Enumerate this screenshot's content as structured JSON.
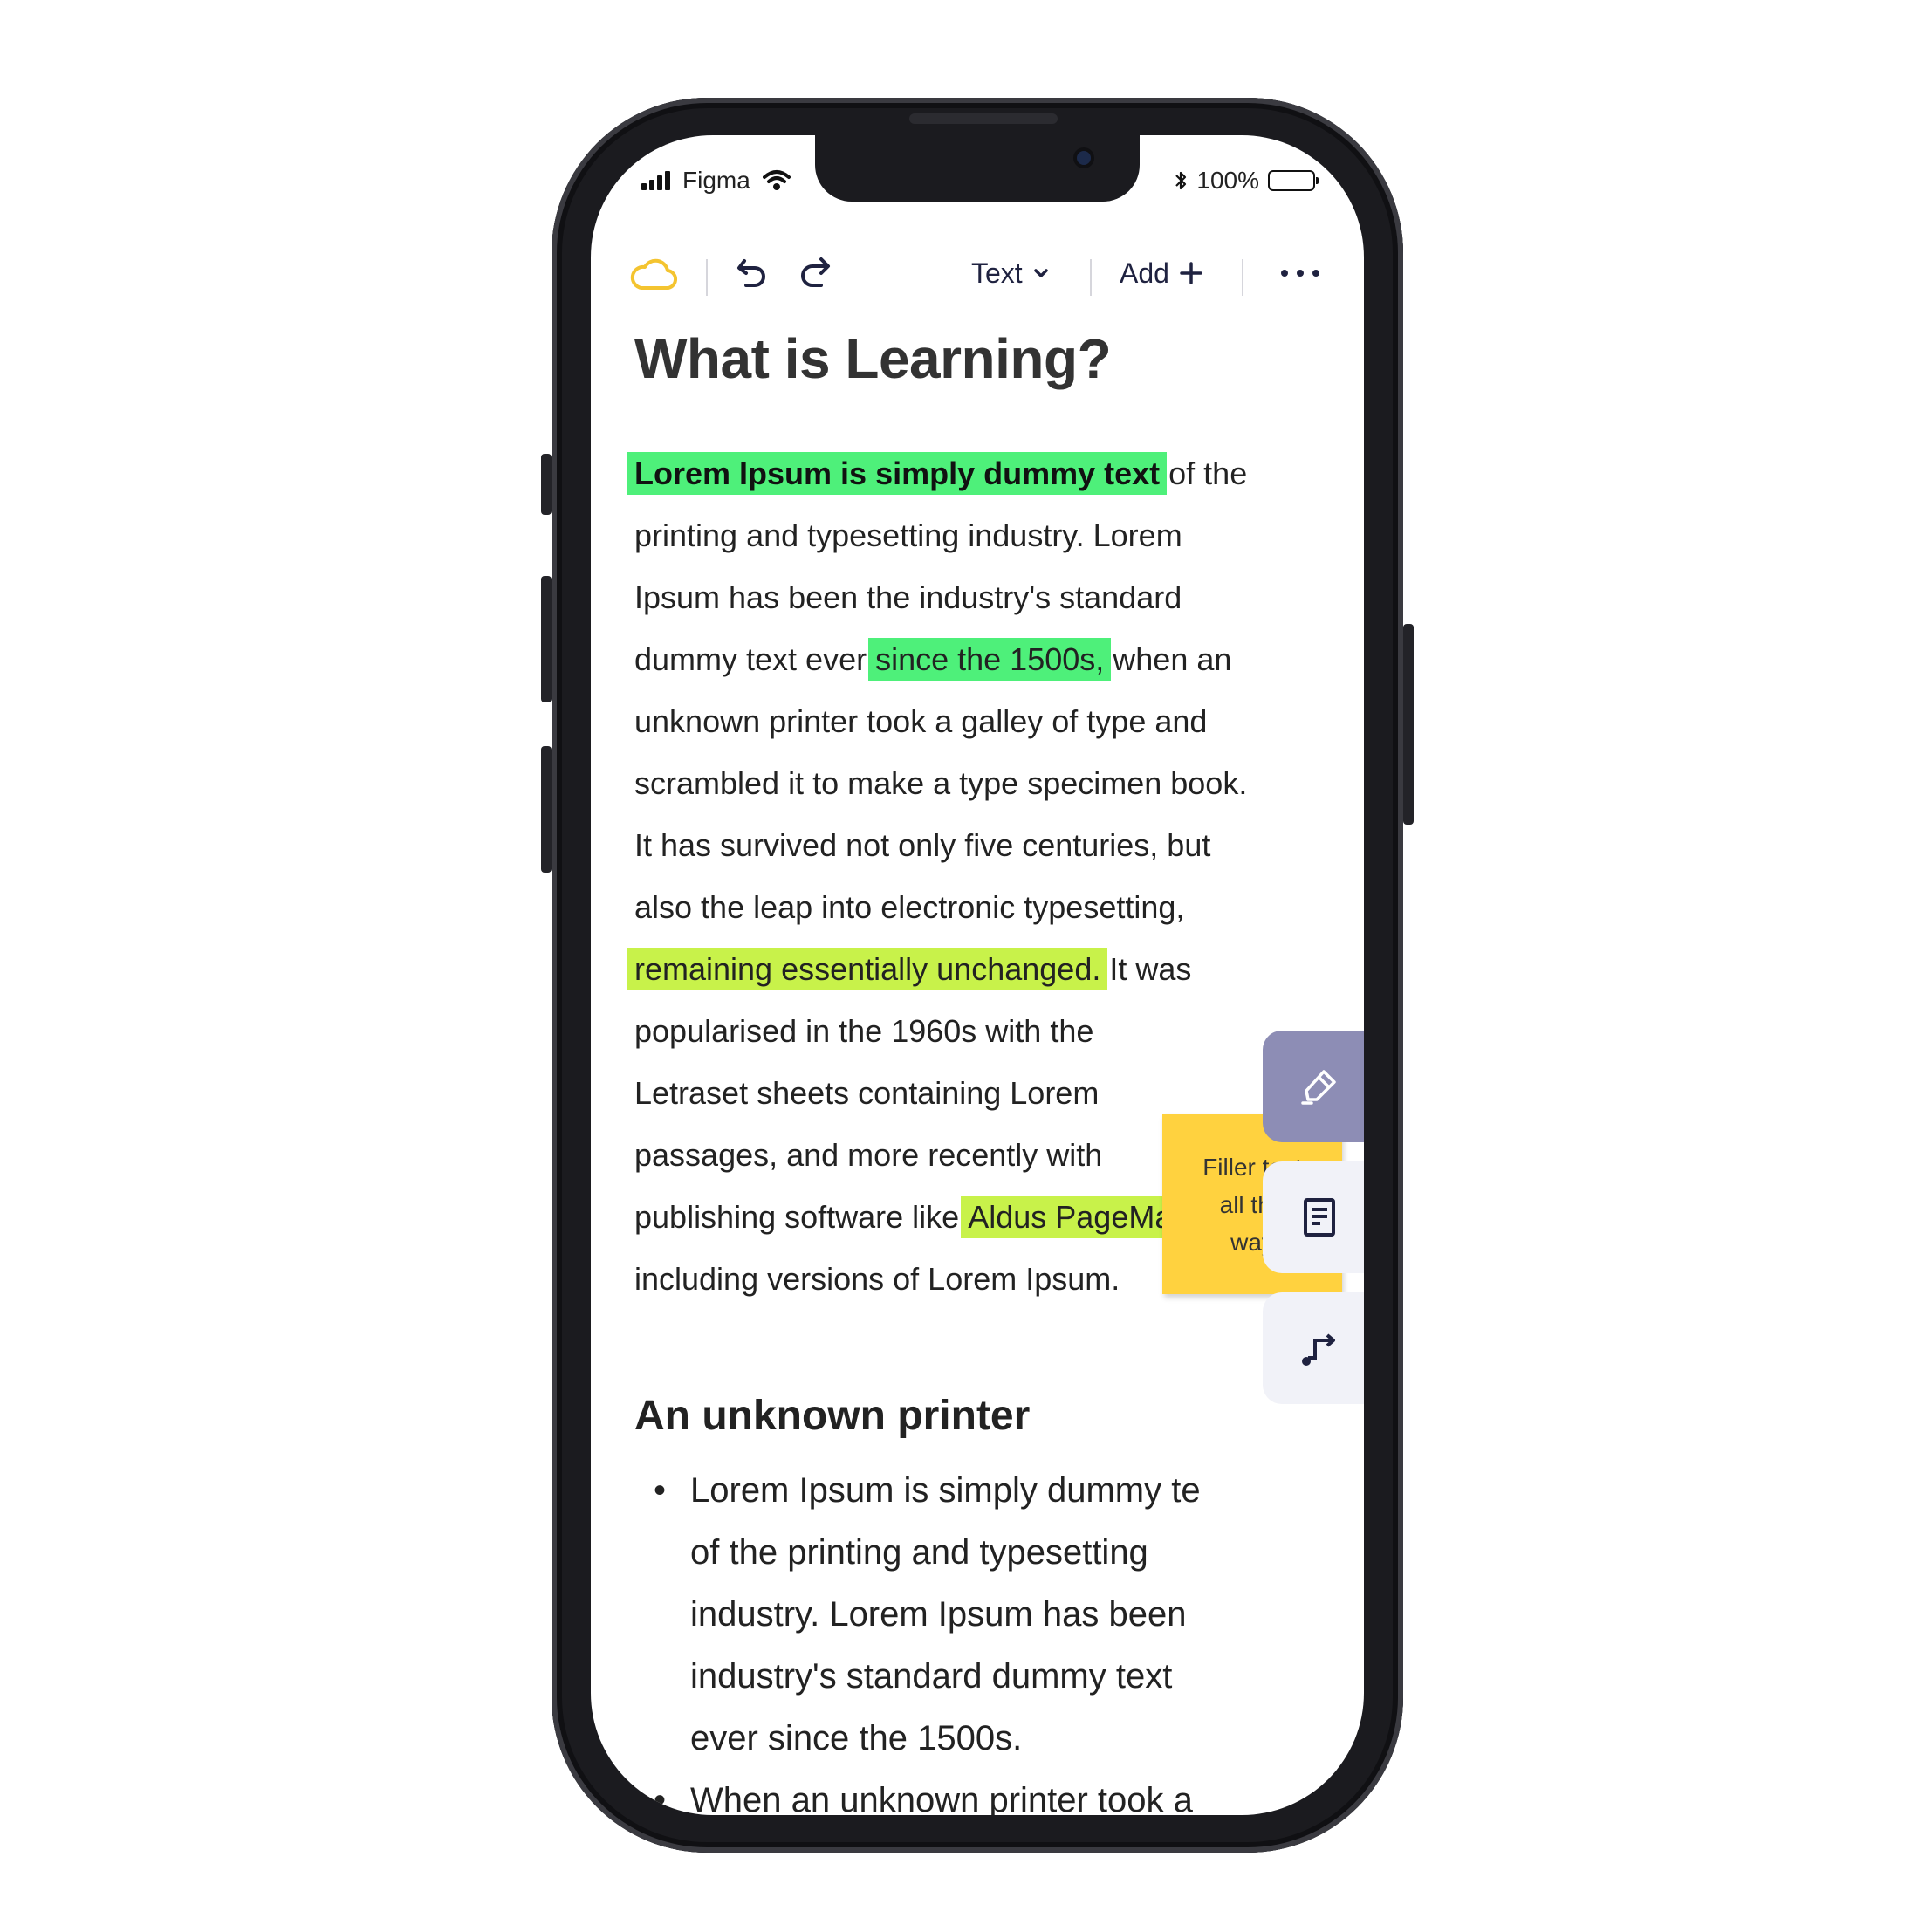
{
  "status_bar": {
    "carrier": "Figma",
    "battery": "100%"
  },
  "toolbar": {
    "text_label": "Text",
    "add_label": "Add",
    "cloud_color": "#f4c430",
    "icons": [
      "cloud-icon",
      "undo-icon",
      "redo-icon",
      "chevron-down-icon",
      "plus-icon",
      "more-icon"
    ]
  },
  "document": {
    "title": "What is Learning?",
    "paragraph_lines": [
      [
        "",
        "Lorem Ipsum is simply dummy text",
        " of the"
      ],
      [
        "printing and typesetting industry. Lorem",
        "",
        ""
      ],
      [
        "Ipsum has been the industry's standard",
        "",
        ""
      ],
      [
        "dummy text ever ",
        "since the 1500s,",
        " when an"
      ],
      [
        "unknown printer took a galley of type and",
        "",
        ""
      ],
      [
        "scrambled it to make a type specimen book.",
        "",
        ""
      ],
      [
        "It has survived not only five centuries, but",
        "",
        ""
      ],
      [
        "also the leap into electronic typesetting,",
        "",
        ""
      ],
      [
        "",
        "remaining essentially unchanged.",
        " It was"
      ],
      [
        "popularised in the 1960s with the",
        "",
        ""
      ],
      [
        "Letraset sheets containing Lorem",
        "",
        ""
      ],
      [
        "passages, and more recently with",
        "",
        ""
      ],
      [
        "publishing software like ",
        "Aldus PageMaker",
        ""
      ],
      [
        "including versions of Lorem Ipsum.",
        "",
        ""
      ]
    ],
    "highlight_colors": {
      "green": "#4ef07a",
      "lime": "#c8f24a"
    },
    "sticky_note": {
      "lines": [
        "Filler text",
        "all the",
        "way"
      ],
      "color": "#ffd23f"
    },
    "section_heading": "An unknown printer",
    "bullets": [
      [
        "Lorem Ipsum is simply dummy te",
        "of the printing and typesetting",
        "industry. Lorem Ipsum has been",
        "industry's standard dummy text",
        "ever since the 1500s."
      ],
      [
        "When an unknown printer took a"
      ]
    ]
  },
  "tools": {
    "items": [
      {
        "name": "highlighter-icon",
        "active": true
      },
      {
        "name": "note-icon",
        "active": false
      },
      {
        "name": "connector-icon",
        "active": false
      }
    ],
    "active_color": "#8d8db5"
  }
}
